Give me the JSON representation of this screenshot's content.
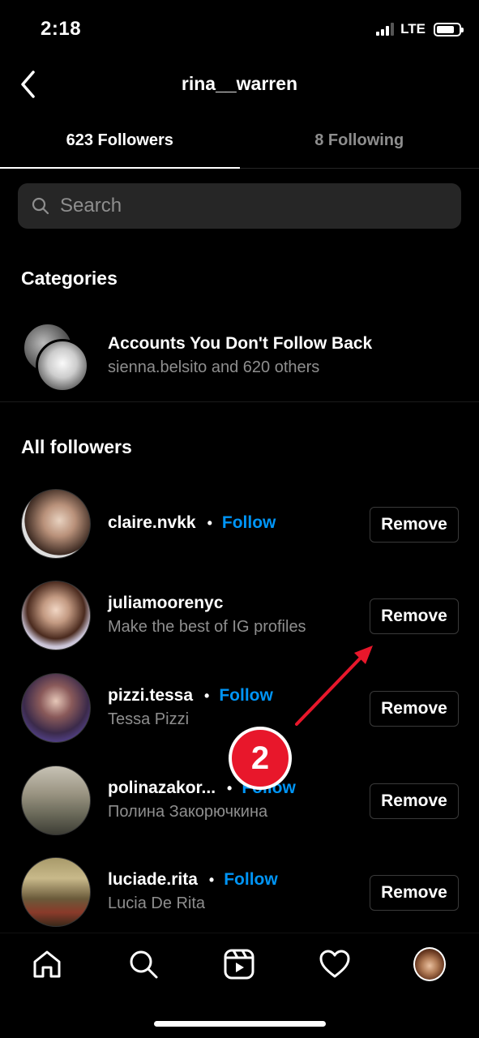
{
  "status_bar": {
    "time": "2:18",
    "network": "LTE"
  },
  "header": {
    "title": "rina__warren"
  },
  "tabs": [
    {
      "label": "623 Followers",
      "active": true
    },
    {
      "label": "8 Following",
      "active": false
    }
  ],
  "search": {
    "placeholder": "Search"
  },
  "categories": {
    "title": "Categories",
    "item": {
      "title": "Accounts You Don't Follow Back",
      "subtitle": "sienna.belsito and 620 others"
    }
  },
  "all_followers": {
    "title": "All followers",
    "follow_label": "Follow",
    "remove_label": "Remove",
    "dot": "•",
    "items": [
      {
        "username": "claire.nvkk",
        "subtitle": "",
        "show_follow": true
      },
      {
        "username": "juliamoorenyc",
        "subtitle": "Make the best of IG profiles",
        "show_follow": false
      },
      {
        "username": "pizzi.tessa",
        "subtitle": "Tessa Pizzi",
        "show_follow": true
      },
      {
        "username": "polinazakor...",
        "subtitle": "Полина Закорючкина",
        "show_follow": true
      },
      {
        "username": "luciade.rita",
        "subtitle": "Lucia De Rita",
        "show_follow": true
      }
    ]
  },
  "annotation": {
    "badge": "2",
    "color": "#e8172b"
  },
  "bottom_nav": [
    "home-icon",
    "search-icon",
    "reels-icon",
    "heart-icon",
    "profile-avatar"
  ],
  "colors": {
    "link": "#0095f6",
    "background": "#000000",
    "secondary_text": "#8e8e8e"
  }
}
